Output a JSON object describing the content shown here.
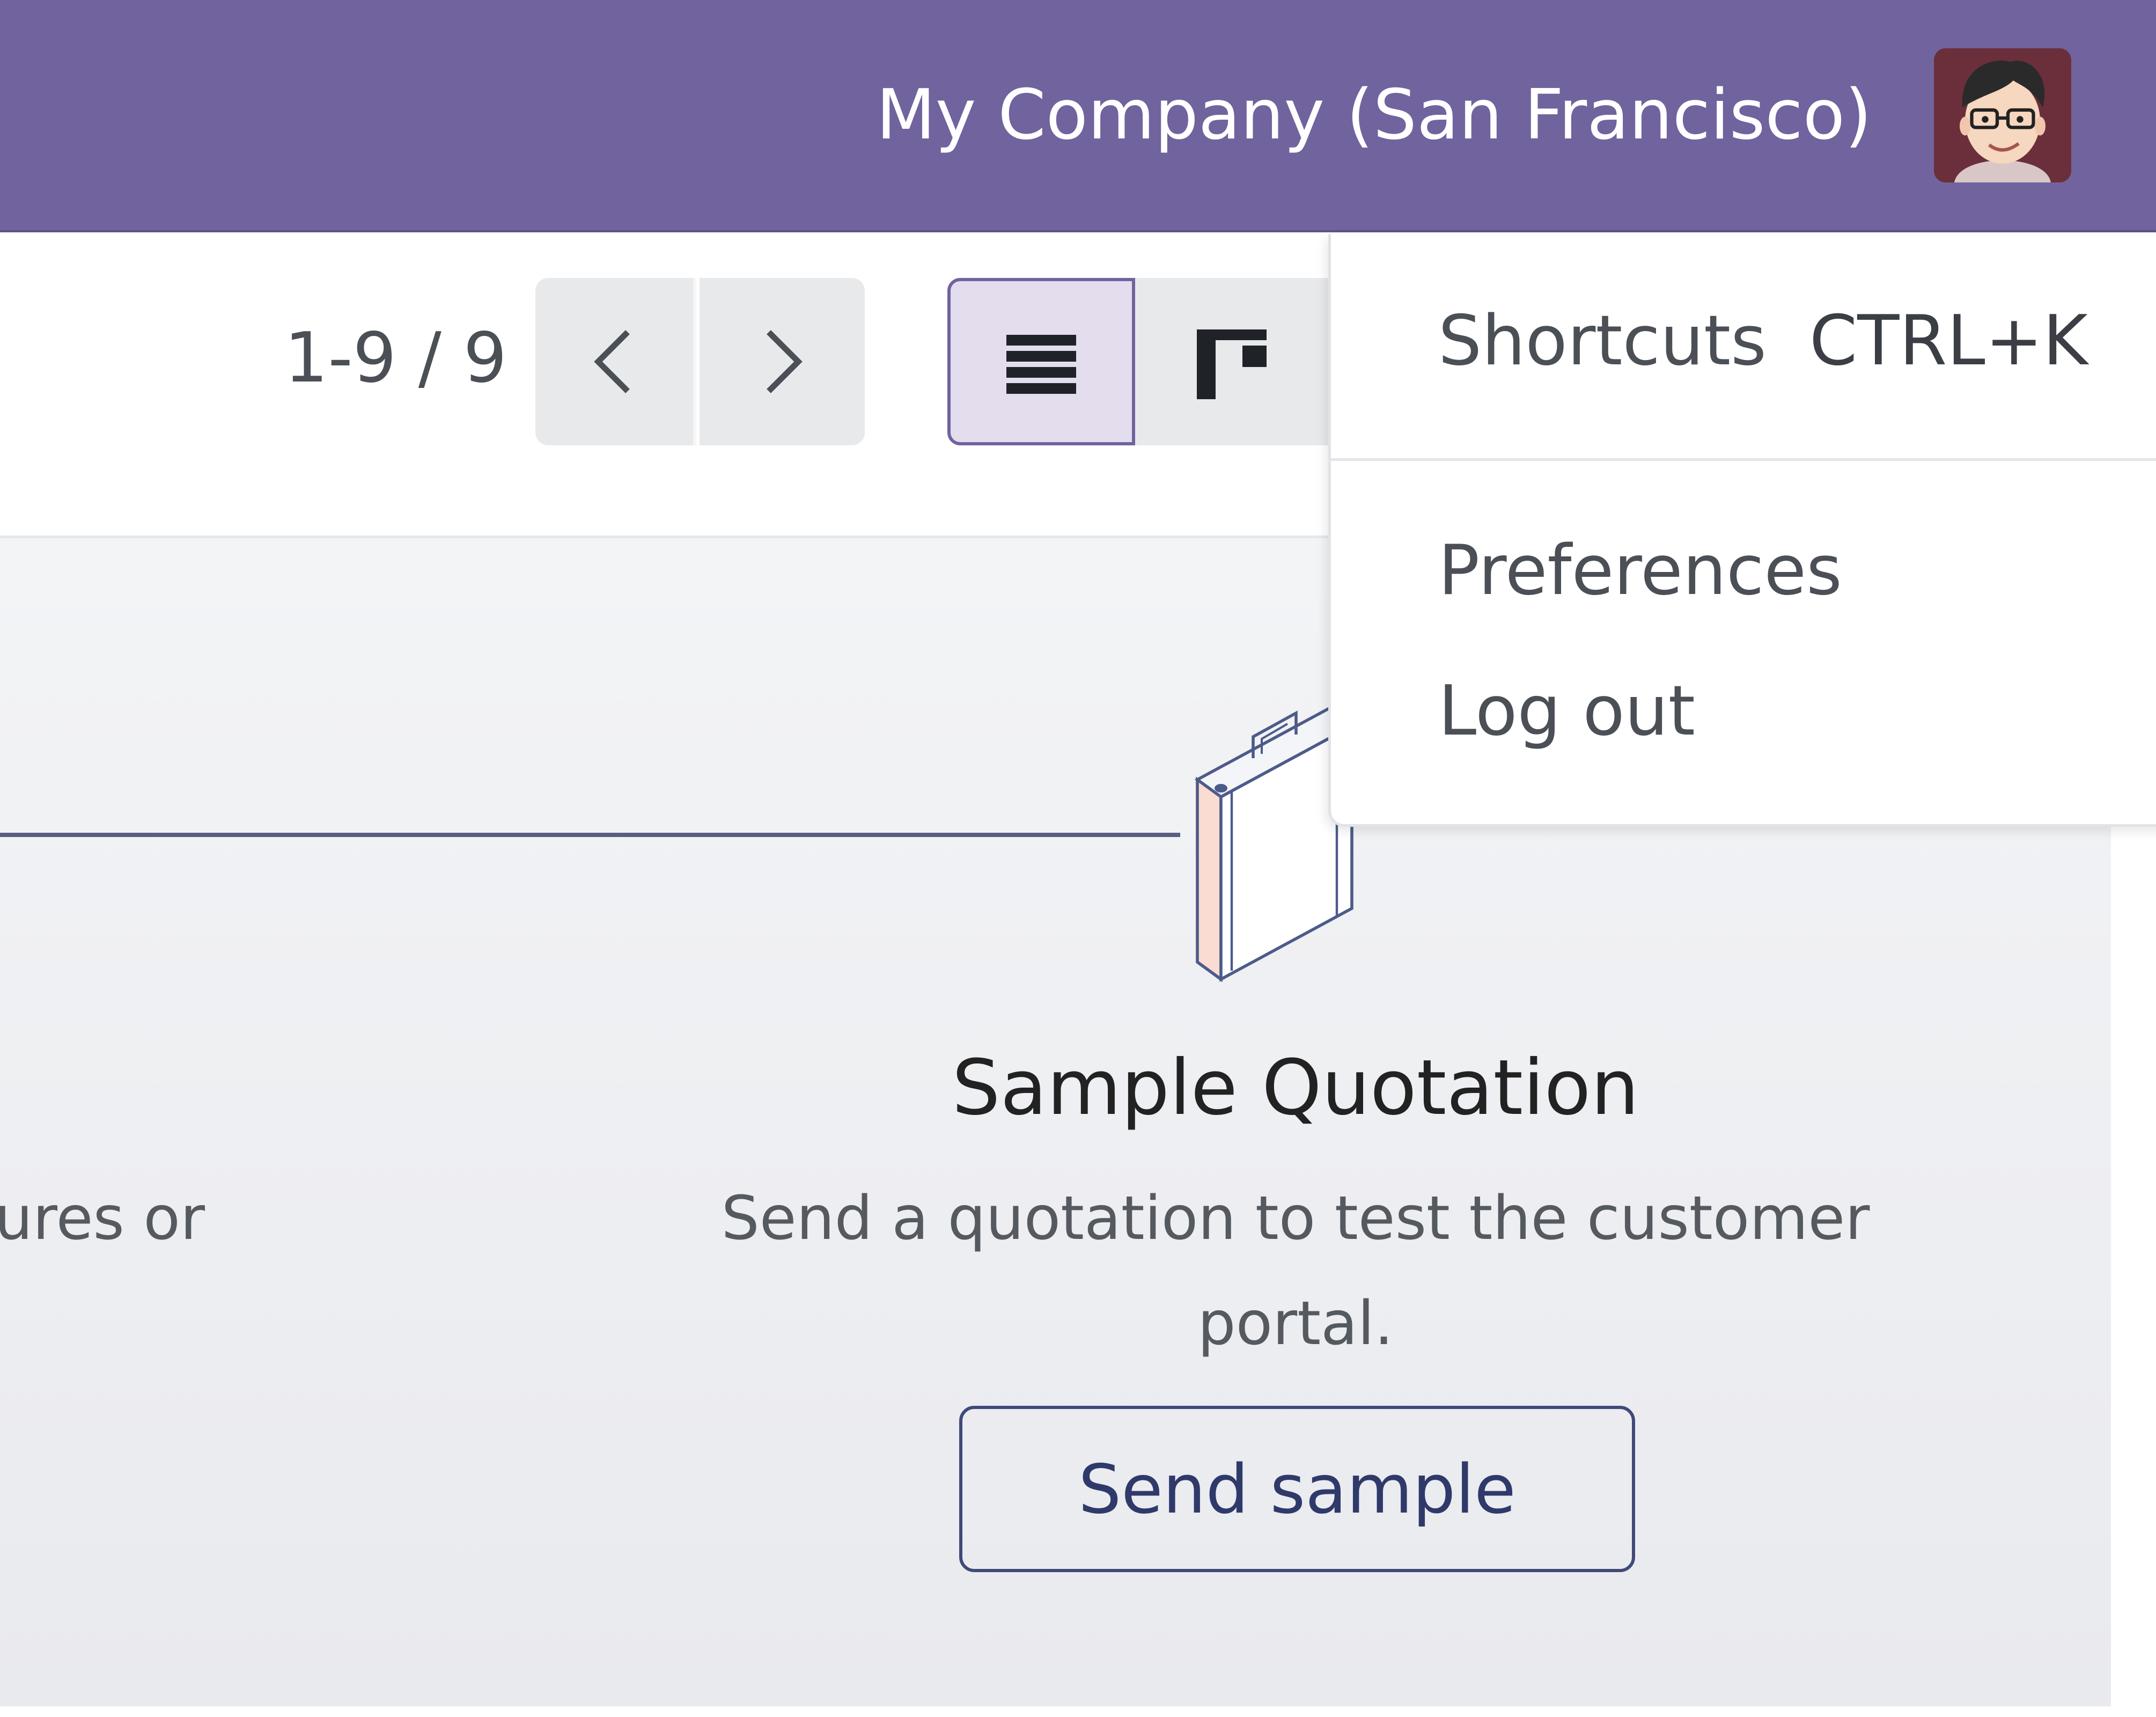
{
  "topbar": {
    "company_label": "My Company (San Francisco)",
    "avatar": "user-avatar-cartoon-with-glasses",
    "color": "#71639e"
  },
  "control_panel": {
    "pager": {
      "value": "1-9 / 9",
      "prev_icon": "chevron-left-icon",
      "next_icon": "chevron-right-icon"
    },
    "views": [
      {
        "name": "list",
        "icon": "list-view-icon",
        "active": true
      },
      {
        "name": "kanban",
        "icon": "kanban-view-icon",
        "active": false
      }
    ]
  },
  "user_menu": {
    "shortcuts_label": "Shortcuts",
    "shortcuts_key": "CTRL+K",
    "preferences_label": "Preferences",
    "logout_label": "Log out"
  },
  "main": {
    "left_text_fragment": "ures or",
    "illustration": "briefcase-illustration",
    "sample_title": "Sample Quotation",
    "sample_description": "Send a quotation to test the customer portal.",
    "send_sample_label": "Send sample"
  }
}
